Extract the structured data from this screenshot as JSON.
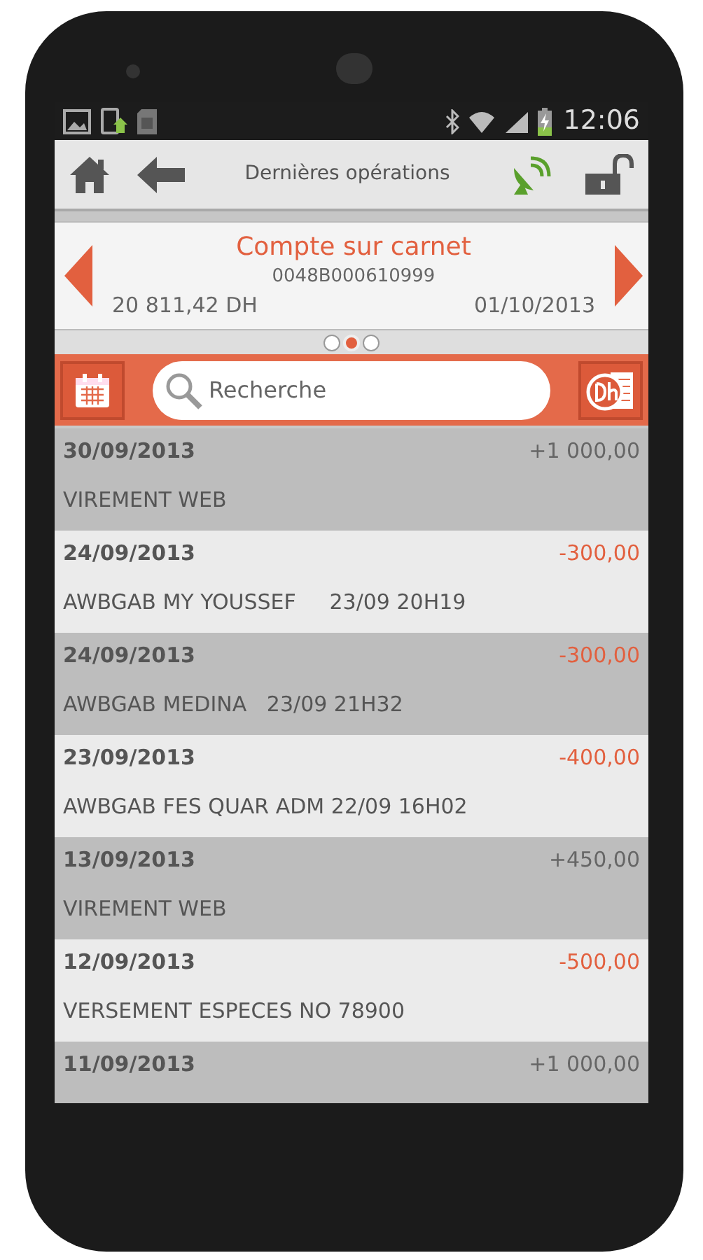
{
  "status_bar": {
    "time": "12:06"
  },
  "app_bar": {
    "title": "Dernières opérations"
  },
  "account": {
    "name": "Compte sur carnet",
    "number": "0048B000610999",
    "balance": "20 811,42 DH",
    "date": "01/10/2013"
  },
  "pager": [
    {
      "selected": false
    },
    {
      "selected": true
    },
    {
      "selected": false
    }
  ],
  "search": {
    "placeholder": "Recherche"
  },
  "operations": [
    {
      "date": "30/09/2013",
      "amount": "+1 000,00",
      "kind": "credit",
      "label": "VIREMENT WEB"
    },
    {
      "date": "24/09/2013",
      "amount": "-300,00",
      "kind": "debit",
      "label": "AWBGAB MY YOUSSEF     23/09 20H19"
    },
    {
      "date": "24/09/2013",
      "amount": "-300,00",
      "kind": "debit",
      "label": "AWBGAB MEDINA   23/09 21H32"
    },
    {
      "date": "23/09/2013",
      "amount": "-400,00",
      "kind": "debit",
      "label": "AWBGAB FES QUAR ADM 22/09 16H02"
    },
    {
      "date": "13/09/2013",
      "amount": "+450,00",
      "kind": "credit",
      "label": "VIREMENT WEB"
    },
    {
      "date": "12/09/2013",
      "amount": "-500,00",
      "kind": "debit",
      "label": "VERSEMENT ESPECES NO 78900"
    },
    {
      "date": "11/09/2013",
      "amount": "+1 000,00",
      "kind": "credit"
    }
  ]
}
